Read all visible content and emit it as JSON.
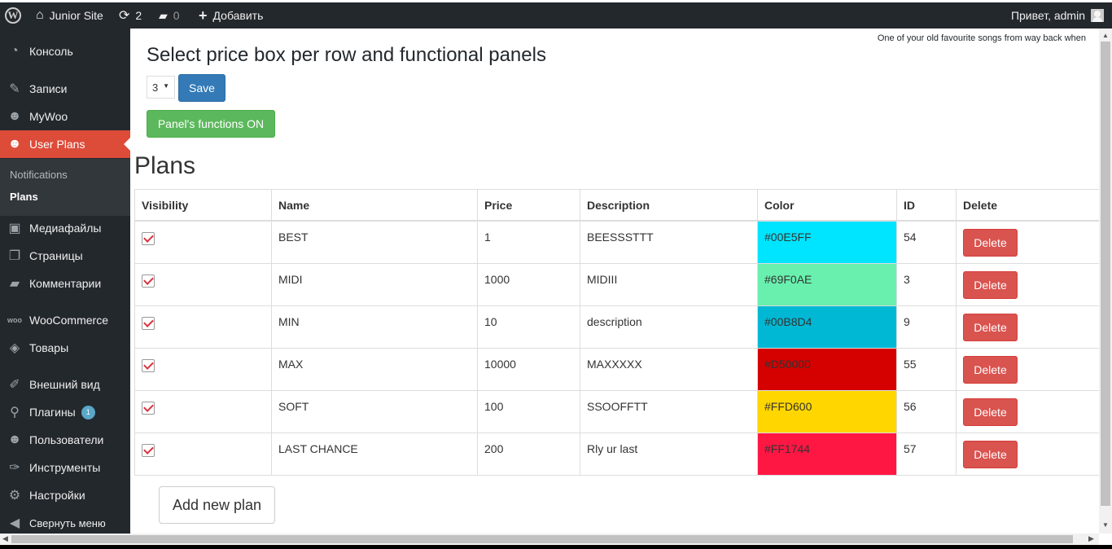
{
  "adminbar": {
    "site_name": "Junior Site",
    "updates_count": "2",
    "comments_count": "0",
    "add_label": "Добавить",
    "greeting": "Привет, admin"
  },
  "sidebar": {
    "items": [
      {
        "label": "Консоль",
        "icon": "dashboard-icon"
      },
      {
        "label": "Записи",
        "icon": "pin-icon"
      },
      {
        "label": "MyWoo",
        "icon": "users-icon"
      },
      {
        "label": "User Plans",
        "icon": "users-icon"
      },
      {
        "label": "Медиафайлы",
        "icon": "media-icon"
      },
      {
        "label": "Страницы",
        "icon": "pages-icon"
      },
      {
        "label": "Комментарии",
        "icon": "comments-icon"
      },
      {
        "label": "WooCommerce",
        "icon": "woo-icon"
      },
      {
        "label": "Товары",
        "icon": "box-icon"
      },
      {
        "label": "Внешний вид",
        "icon": "brush-icon"
      },
      {
        "label": "Плагины",
        "icon": "plugin-icon",
        "badge": "1"
      },
      {
        "label": "Пользователи",
        "icon": "user-icon"
      },
      {
        "label": "Инструменты",
        "icon": "wrench-icon"
      },
      {
        "label": "Настройки",
        "icon": "settings-icon"
      },
      {
        "label": "Свернуть меню",
        "icon": "collapse-icon"
      }
    ],
    "submenu": [
      {
        "label": "Notifications"
      },
      {
        "label": "Plans"
      }
    ]
  },
  "main": {
    "hello_dolly": "One of your old favourite songs from way back when",
    "heading": "Select price box per row and functional panels",
    "per_row_value": "3",
    "save_label": "Save",
    "panel_toggle_label": "Panel's functions ON",
    "plans_heading": "Plans",
    "add_plan_label": "Add new plan"
  },
  "table": {
    "headers": [
      "Visibility",
      "Name",
      "Price",
      "Description",
      "Color",
      "ID",
      "Delete"
    ],
    "rows": [
      {
        "visible": true,
        "name": "BEST",
        "price": "1",
        "description": "BEESSSTTT",
        "color": "#00E5FF",
        "id": "54",
        "delete": "Delete"
      },
      {
        "visible": true,
        "name": "MIDI",
        "price": "1000",
        "description": "MIDIII",
        "color": "#69F0AE",
        "id": "3",
        "delete": "Delete"
      },
      {
        "visible": true,
        "name": "MIN",
        "price": "10",
        "description": "description",
        "color": "#00B8D4",
        "id": "9",
        "delete": "Delete"
      },
      {
        "visible": true,
        "name": "MAX",
        "price": "10000",
        "description": "MAXXXXX",
        "color": "#D50000",
        "id": "55",
        "delete": "Delete"
      },
      {
        "visible": true,
        "name": "SOFT",
        "price": "100",
        "description": "SSOOFFTT",
        "color": "#FFD600",
        "id": "56",
        "delete": "Delete"
      },
      {
        "visible": true,
        "name": "LAST CHANCE",
        "price": "200",
        "description": "Rly ur last",
        "color": "#FF1744",
        "id": "57",
        "delete": "Delete"
      }
    ]
  }
}
